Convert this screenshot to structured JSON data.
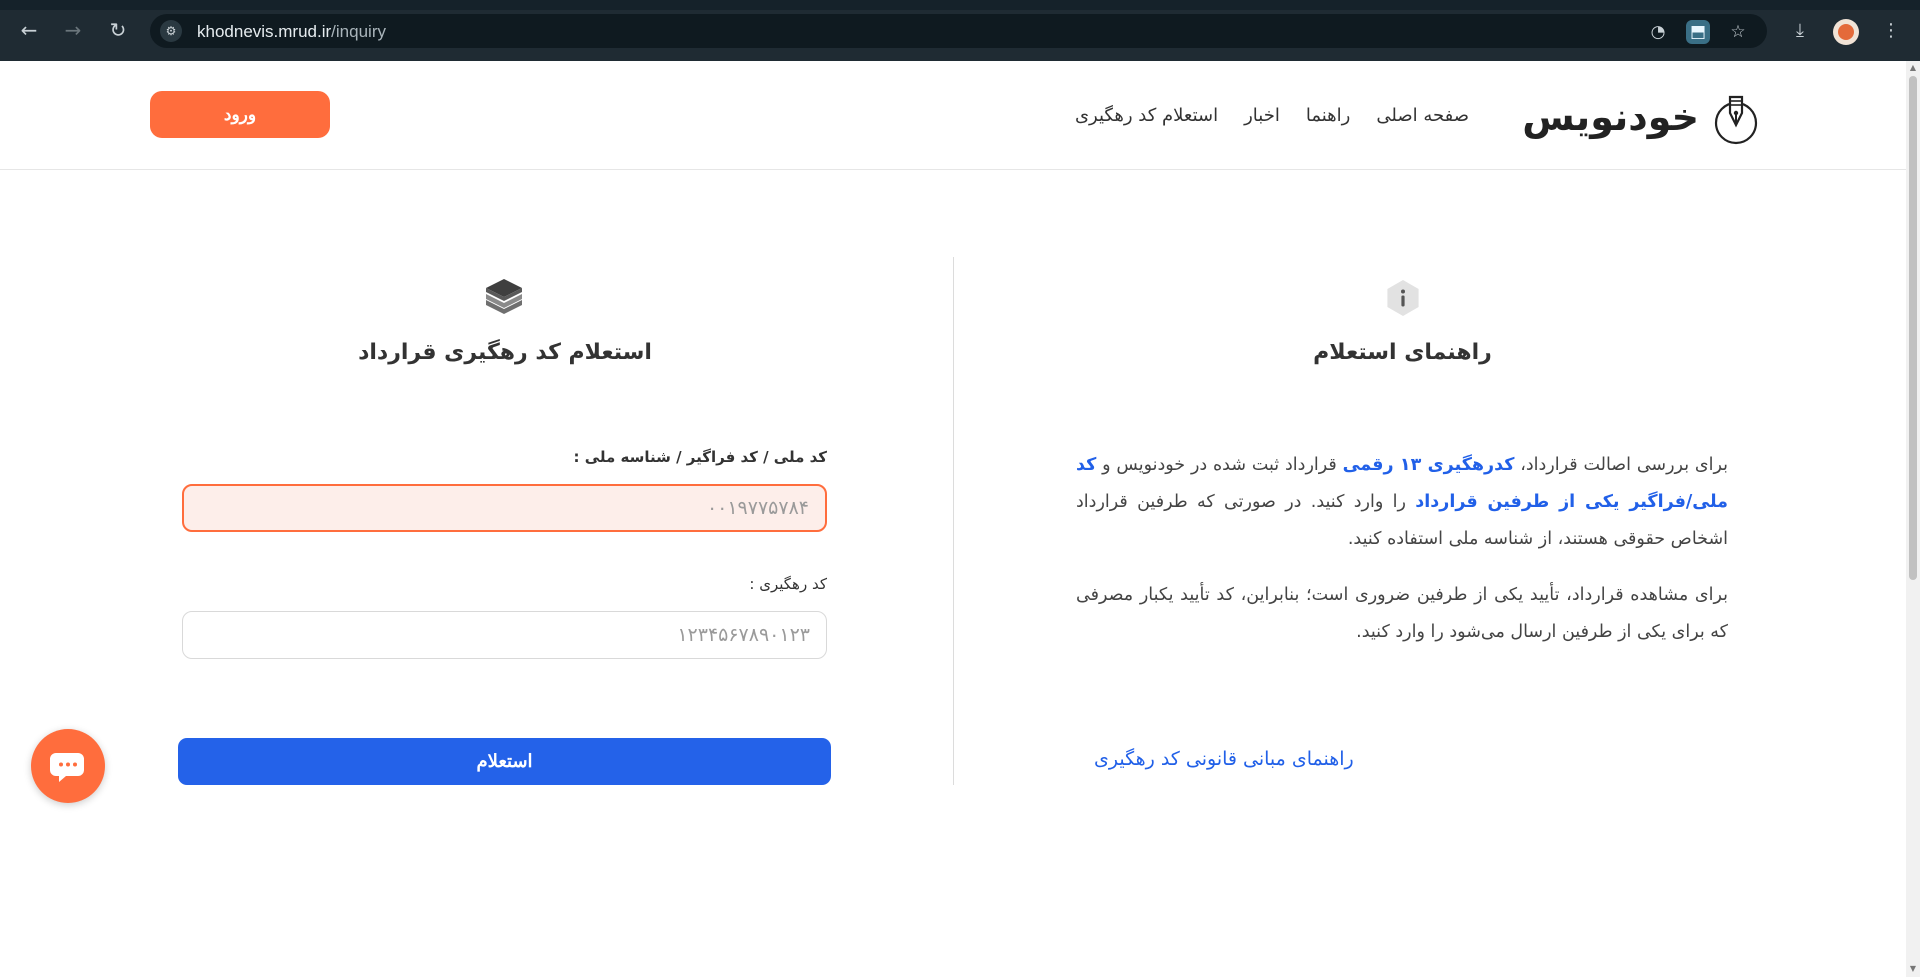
{
  "browser": {
    "url_host": "khodnevis.mrud.ir",
    "url_path": "/inquiry",
    "icons": [
      "back-icon",
      "forward-icon",
      "reload-icon",
      "site-settings-icon",
      "performance-icon",
      "install-app-icon",
      "bookmark-star-icon",
      "download-icon",
      "profile-avatar",
      "menu-dots-icon"
    ]
  },
  "header": {
    "logo_text": "خودنویس",
    "nav": [
      "صفحه اصلی",
      "راهنما",
      "اخبار",
      "استعلام کد رهگیری"
    ],
    "login_label": "ورود"
  },
  "guide": {
    "title": "راهنمای استعلام",
    "p1_a": "برای بررسی اصالت قرارداد، ",
    "p1_b": "کدرهگیری ۱۳ رقمی",
    "p1_c": " قرارداد ثبت شده در خودنویس و ",
    "p1_d": "کد ملی/فراگیر یکی از طرفین قرارداد",
    "p1_e": " را وارد کنید. در صورتی که طرفین قرارداد اشخاص حقوقی هستند، از شناسه ملی استفاده کنید.",
    "p2": "برای مشاهده قرارداد، تأیید یکی از طرفین ضروری است؛ بنابراین، کد تأیید یکبار مصرفی که برای یکی از طرفین ارسال می‌شود را وارد کنید.",
    "legal_link": "راهنمای مبانی قانونی کد رهگیری"
  },
  "form": {
    "title": "استعلام کد رهگیری قرارداد",
    "national_code_label": "کد ملی / کد فراگیر / شناسه ملی :",
    "national_code_placeholder": "۰۰۱۹۷۷۵۷۸۴",
    "tracking_code_label": "کد رهگیری :",
    "tracking_code_placeholder": "۱۲۳۴۵۶۷۸۹۰۱۲۳",
    "submit_label": "استعلام"
  },
  "colors": {
    "accent_orange": "#ff6d3d",
    "primary_blue": "#2462e9",
    "link_blue": "#2160e8",
    "chrome_bg": "#1f2b33"
  }
}
